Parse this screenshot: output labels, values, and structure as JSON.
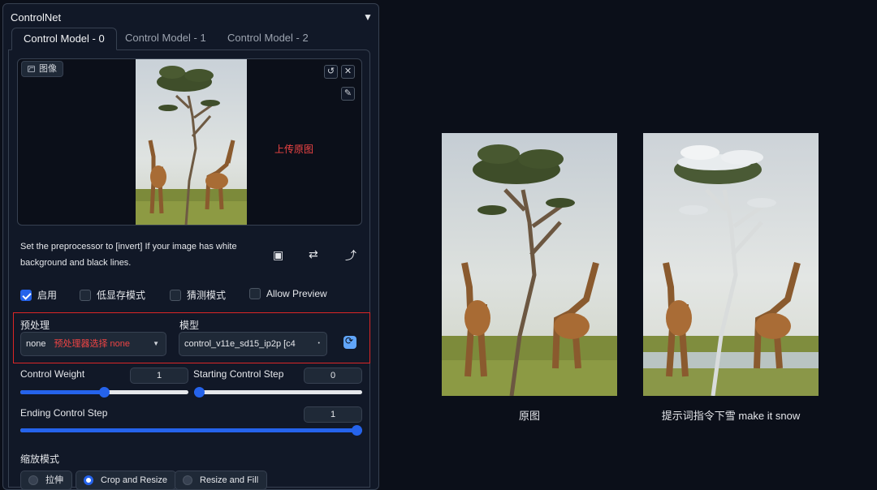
{
  "panel": {
    "title": "ControlNet"
  },
  "tabs": [
    "Control Model - 0",
    "Control Model - 1",
    "Control Model - 2"
  ],
  "upload": {
    "badge": "图像",
    "note": "上传原图"
  },
  "hint": "Set the preprocessor to [invert] If your image has white background and black lines.",
  "checkboxes": [
    {
      "label": "启用",
      "checked": true
    },
    {
      "label": "低显存模式",
      "checked": false
    },
    {
      "label": "猜测模式",
      "checked": false
    },
    {
      "label": "Allow Preview",
      "checked": false
    }
  ],
  "preprocessor": {
    "label": "预处理",
    "value": "none",
    "note": "预处理器选择 none"
  },
  "model": {
    "label": "模型",
    "value": "control_v11e_sd15_ip2p [c4"
  },
  "sliders": {
    "control_weight": {
      "label": "Control Weight",
      "value": "1",
      "fraction": 0.5
    },
    "starting_step": {
      "label": "Starting Control Step",
      "value": "0",
      "fraction": 0
    },
    "ending_step": {
      "label": "Ending Control Step",
      "value": "1",
      "fraction": 1
    }
  },
  "resize_mode": {
    "label": "缩放模式",
    "options": [
      "拉伸",
      "Crop and Resize",
      "Resize and Fill"
    ],
    "selected": "Crop and Resize"
  },
  "showcase": {
    "original_caption": "原图",
    "result_caption": "提示词指令下雪 make it snow"
  },
  "colors": {
    "accent": "#2563eb",
    "note_red": "#ef4444",
    "background": "#0b0f19"
  }
}
